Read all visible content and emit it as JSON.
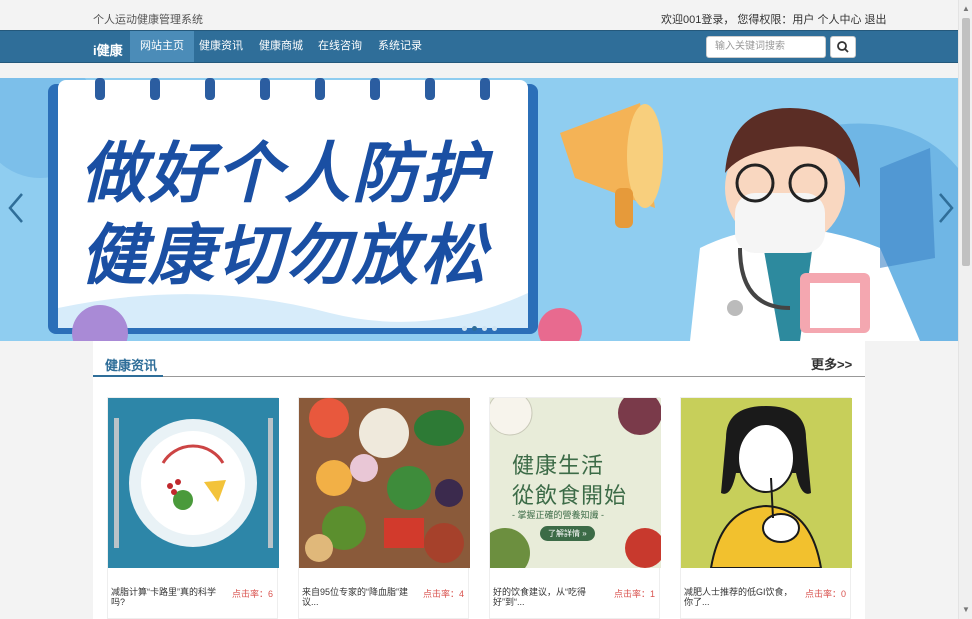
{
  "topbar": {
    "site_name": "个人运动健康管理系统",
    "welcome": "欢迎001登录，",
    "role_text": "您得权限：用户",
    "user_center": "个人中心",
    "logout": "退出"
  },
  "navbar": {
    "brand": "i健康",
    "items": [
      {
        "label": "网站主页",
        "active": true
      },
      {
        "label": "健康资讯"
      },
      {
        "label": "健康商城"
      },
      {
        "label": "在线咨询"
      },
      {
        "label": "系统记录"
      }
    ],
    "search_placeholder": "输入关键词搜索"
  },
  "banner": {
    "line1": "做好个人防护",
    "line2": "健康切勿放松",
    "slide_count": 4,
    "active_slide": 2
  },
  "news": {
    "title": "健康资讯",
    "more": "更多>>",
    "cards": [
      {
        "title": "减脂计算“卡路里”真的科学吗?",
        "clicks": "点击率：6"
      },
      {
        "title": "来自95位专家的“降血脂”建议...",
        "clicks": "点击率：4"
      },
      {
        "title": "好的饮食建议，从“吃得好”到“...",
        "clicks": "点击率：1"
      },
      {
        "title": "减肥人士推荐的低GI饮食，你了...",
        "clicks": "点击率：0"
      }
    ],
    "card3_image": {
      "heading1": "健康生活",
      "heading2": "從飲食開始",
      "sub": "- 掌握正確的營養知識 -",
      "button": "了解詳情 »"
    }
  },
  "colors": {
    "primary": "#2f6e99",
    "active_nav": "#4b8cb8",
    "clicks": "#d9534f"
  }
}
